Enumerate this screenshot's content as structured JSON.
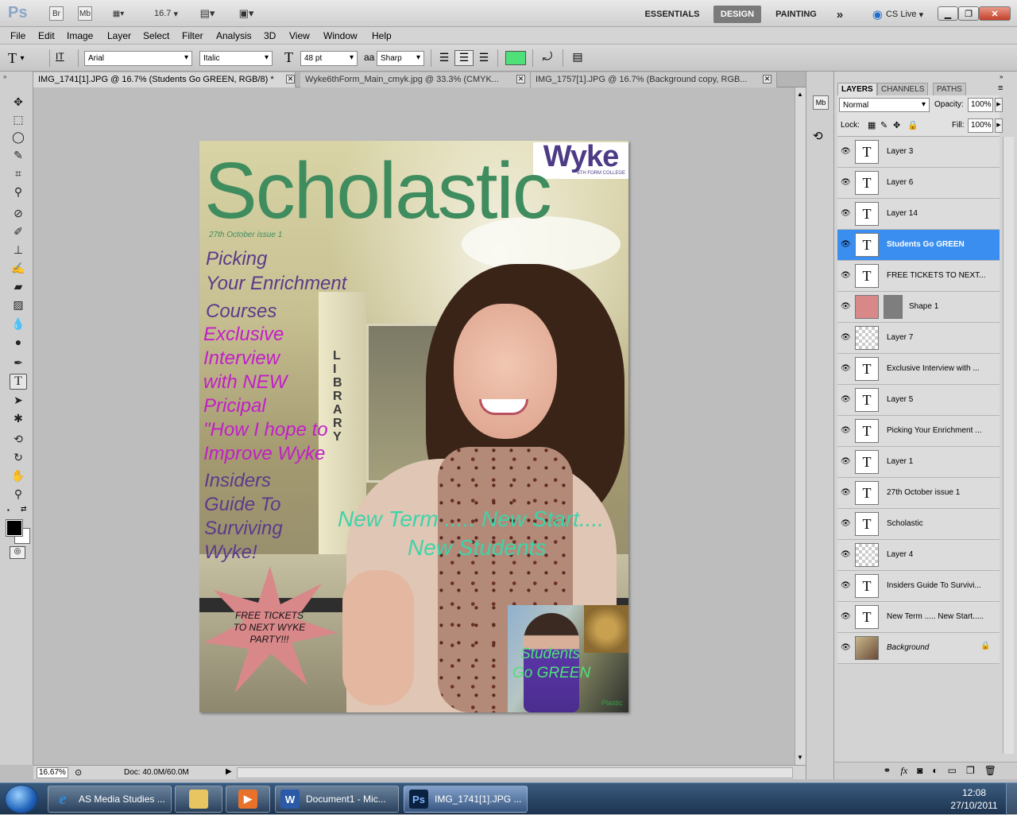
{
  "appbar": {
    "logo": "Ps",
    "btn_br": "Br",
    "btn_mb": "Mb",
    "zoom_value": "16.7",
    "workspaces": [
      "ESSENTIALS",
      "DESIGN",
      "PAINTING"
    ],
    "more": "»",
    "cslive": "CS Live"
  },
  "menu": [
    "File",
    "Edit",
    "Image",
    "Layer",
    "Select",
    "Filter",
    "Analysis",
    "3D",
    "View",
    "Window",
    "Help"
  ],
  "options": {
    "tool_glyph": "T",
    "orient_glyph": "IT",
    "font_family": "Arial",
    "font_style": "Italic",
    "size_glyph": "T",
    "font_size": "48 pt",
    "aa_glyph": "aa",
    "antialias": "Sharp",
    "text_color": "#4fe07a"
  },
  "tabs": [
    {
      "label": "IMG_1741[1].JPG @ 16.7% (Students  Go GREEN, RGB/8) *"
    },
    {
      "label": "Wyke6thForm_Main_cmyk.jpg @ 33.3% (CMYK..."
    },
    {
      "label": "IMG_1757[1].JPG @ 16.7% (Background copy, RGB..."
    }
  ],
  "document": {
    "logo": "Wyke",
    "logo_sub": "6TH FORM COLLEGE",
    "title": "Scholastic",
    "issue": "27th October issue 1",
    "story1_lines": [
      "Picking",
      "Your Enrichment",
      "Courses"
    ],
    "story2_lines": [
      "Exclusive",
      "Interview",
      "with NEW",
      "Pricipal",
      "\"How I hope to",
      "Improve Wyke"
    ],
    "story3_lines": [
      "Insiders",
      "Guide To",
      "Surviving",
      "Wyke!"
    ],
    "sign": "LIBRARY",
    "tagline1": "New Term ..... New Start....",
    "tagline2": "New Students",
    "star_text": "FREE TICKETS TO NEXT WYKE PARTY!!!",
    "inset_text1": "Students",
    "inset_text2": "Go GREEN",
    "inset_sign": "Plastic"
  },
  "status": {
    "zoom": "16.67%",
    "doc": "Doc: 40.0M/60.0M"
  },
  "panel": {
    "tabs": [
      "LAYERS",
      "CHANNELS",
      "PATHS"
    ],
    "blend": "Normal",
    "opacity_label": "Opacity:",
    "opacity": "100%",
    "lock_label": "Lock:",
    "fill_label": "Fill:",
    "fill": "100%",
    "layers": [
      {
        "name": "Layer 3",
        "kind": "text"
      },
      {
        "name": "Layer 6",
        "kind": "text"
      },
      {
        "name": "Layer 14",
        "kind": "text"
      },
      {
        "name": "Students  Go GREEN",
        "kind": "text",
        "selected": true
      },
      {
        "name": "FREE  TICKETS TO NEXT...",
        "kind": "text"
      },
      {
        "name": "Shape 1",
        "kind": "shape"
      },
      {
        "name": "Layer 7",
        "kind": "pixel"
      },
      {
        "name": "Exclusive  Interview with ...",
        "kind": "text"
      },
      {
        "name": "Layer 5",
        "kind": "text"
      },
      {
        "name": "Picking Your Enrichment ...",
        "kind": "text"
      },
      {
        "name": "Layer 1",
        "kind": "text"
      },
      {
        "name": "27th October issue 1",
        "kind": "text"
      },
      {
        "name": "Scholastic",
        "kind": "text"
      },
      {
        "name": "Layer 4",
        "kind": "pixel"
      },
      {
        "name": "Insiders Guide To Survivi...",
        "kind": "text"
      },
      {
        "name": "New Term ..... New Start.....",
        "kind": "text"
      },
      {
        "name": "Background",
        "kind": "background"
      }
    ],
    "footer_icons": [
      "link-icon",
      "fx-icon",
      "mask-icon",
      "adjustment-icon",
      "folder-icon",
      "new-layer-icon",
      "trash-icon"
    ]
  },
  "taskbar": {
    "items": [
      {
        "label": "AS Media Studies ...",
        "icon": "ie-icon"
      },
      {
        "label": "",
        "icon": "explorer-icon"
      },
      {
        "label": "",
        "icon": "media-player-icon"
      },
      {
        "label": "Document1 - Mic...",
        "icon": "word-icon"
      },
      {
        "label": "IMG_1741[1].JPG ...",
        "icon": "photoshop-icon"
      }
    ],
    "time": "12:08",
    "date": "27/10/2011"
  },
  "colors": {
    "title_green": "#3f8c5e",
    "purple_text": "#5b3a8a",
    "magenta_text": "#c21ec9",
    "teal_text": "#3fd3a9",
    "star_pink": "#d9888a",
    "selection_blue": "#3a8ef0"
  }
}
